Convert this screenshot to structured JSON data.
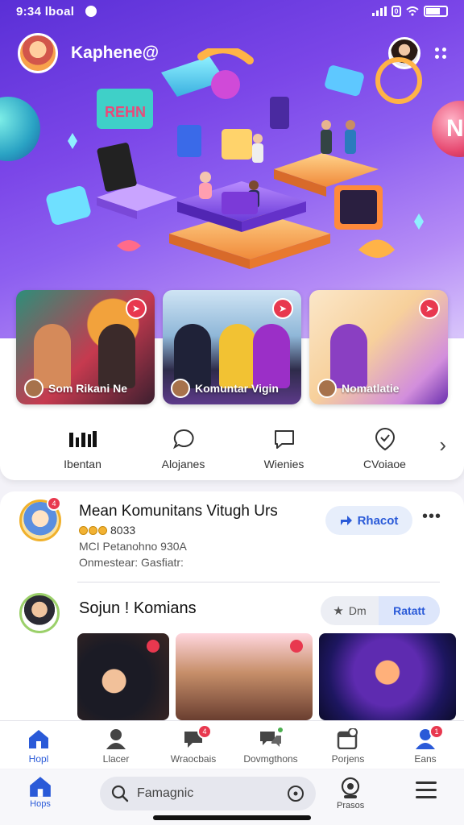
{
  "status_bar": {
    "time": "9:34 lboal"
  },
  "header": {
    "app_title": "Kaphene@"
  },
  "feature_cards": [
    {
      "label": "Som Rikani Ne",
      "share_icon": "share-icon"
    },
    {
      "label": "Komuntar Vigin",
      "share_icon": "share-icon"
    },
    {
      "label": "Nomatlatie",
      "share_icon": "share-icon"
    }
  ],
  "categories": [
    {
      "label": "Ibentan",
      "icon": "bar-chart-icon"
    },
    {
      "label": "Alojanes",
      "icon": "chat-bubble-icon"
    },
    {
      "label": "Wienies",
      "icon": "message-icon"
    },
    {
      "label": "CVoiaoe",
      "icon": "location-pin-icon"
    }
  ],
  "post1": {
    "title": "Mean Komunitans Vitugh Urs",
    "meta_value": "8033",
    "line2": "MCI Petanohno 930A",
    "line3": "Onmestear: Gasfiatr:",
    "share_label": "Rhacot",
    "badge": "4"
  },
  "post2": {
    "title": "Sojun ! Komians",
    "seg_left": "Dm",
    "seg_right": "Ratatt"
  },
  "nav": [
    {
      "label": "Hopl",
      "icon": "home-icon",
      "active": true
    },
    {
      "label": "Llacer",
      "icon": "user-group-icon",
      "badge": ""
    },
    {
      "label": "Wraocbais",
      "icon": "chat-icon",
      "badge": "4"
    },
    {
      "label": "Dovmgthons",
      "icon": "comments-icon",
      "badge": ""
    },
    {
      "label": "Porjens",
      "icon": "calendar-icon",
      "badge": ""
    },
    {
      "label": "Eans",
      "icon": "profile-icon",
      "badge": "1"
    }
  ],
  "dock": {
    "home_label": "Hops",
    "search_placeholder": "Famagnic",
    "camera_label": "Prasos"
  },
  "colors": {
    "hero_start": "#5a2fd6",
    "accent_blue": "#2a5ad8",
    "alert_red": "#e8384f"
  }
}
